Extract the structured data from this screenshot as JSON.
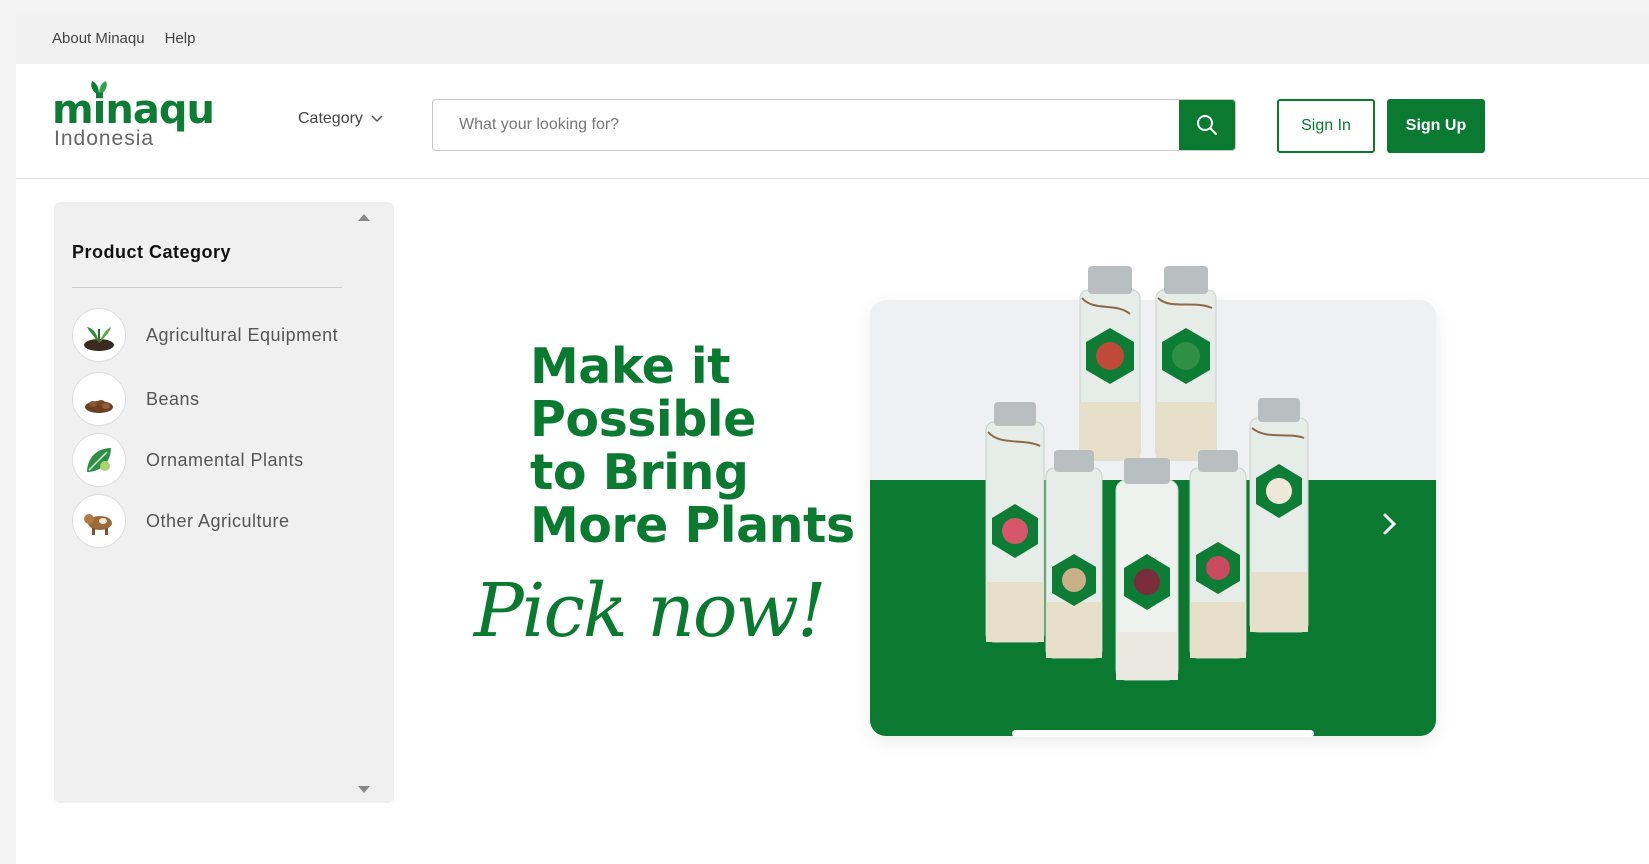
{
  "topbar": {
    "links": [
      "About Minaqu",
      "Help"
    ]
  },
  "header": {
    "logo_word": "minaqu",
    "logo_sub": "Indonesia",
    "category_label": "Category",
    "search_placeholder": "What your looking for?",
    "signin_label": "Sign In",
    "signup_label": "Sign Up"
  },
  "sidebar": {
    "title": "Product Category",
    "items": [
      {
        "label": "Agricultural Equipment",
        "icon": "sprout-icon"
      },
      {
        "label": "Beans",
        "icon": "beans-icon"
      },
      {
        "label": "Ornamental Plants",
        "icon": "leaf-plant-icon"
      },
      {
        "label": "Other Agriculture",
        "icon": "livestock-icon"
      }
    ]
  },
  "banner": {
    "headline_lines": [
      "Make it",
      "Possible",
      "to Bring",
      "More Plants"
    ],
    "script_text": "Pick now!"
  },
  "colors": {
    "brand_green": "#0a7a31",
    "topbar_bg": "#f1f1f1",
    "sidebar_bg": "#f0f0f0"
  }
}
